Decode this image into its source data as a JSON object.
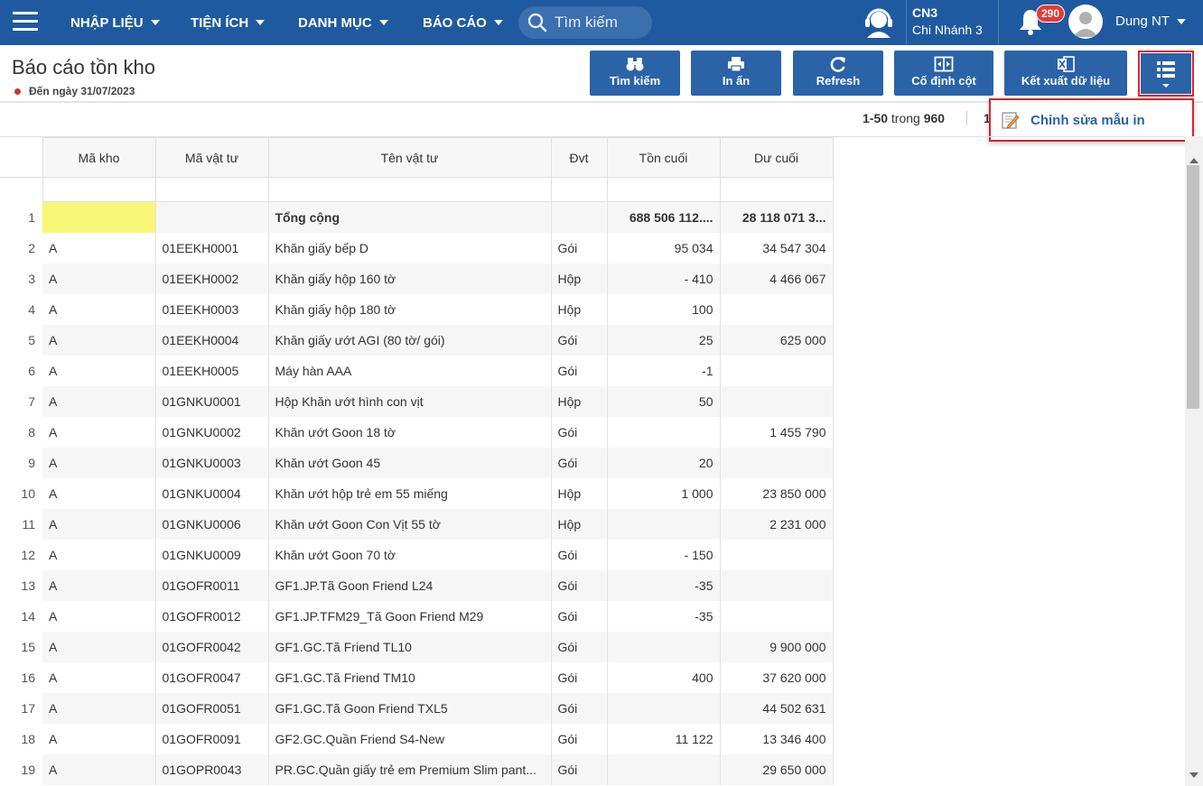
{
  "nav": {
    "menus": [
      "NHẬP LIỆU",
      "TIỆN ÍCH",
      "DANH MỤC",
      "BÁO CÁO"
    ],
    "search_placeholder": "Tìm kiếm",
    "branch_code": "CN3",
    "branch_name": "Chi Nhánh 3",
    "notification_count": "290",
    "user_name": "Dung NT"
  },
  "page": {
    "title": "Báo cáo tồn kho",
    "subtitle": "Đến ngày 31/07/2023"
  },
  "toolbar": {
    "search": "Tìm kiếm",
    "print": "In ấn",
    "refresh": "Refresh",
    "freeze": "Cố định cột",
    "export": "Kết xuất dữ liệu"
  },
  "dropdown": {
    "edit_template": "Chỉnh sửa mẫu in"
  },
  "pager": {
    "range": "1-50",
    "of": "trong",
    "total": "960",
    "page": "1"
  },
  "table": {
    "columns": [
      "Mã kho",
      "Mã vật tư",
      "Tên vật tư",
      "Đvt",
      "Tồn cuối",
      "Dư cuối"
    ],
    "total": {
      "idx": "1",
      "label": "Tổng cộng",
      "ton": "688 506 112....",
      "du": "28 118 071 3..."
    },
    "rows": [
      [
        "2",
        "A",
        "01EEKH0001",
        "Khăn giấy bếp D",
        "Gói",
        "95 034",
        "34 547 304"
      ],
      [
        "3",
        "A",
        "01EEKH0002",
        "Khăn giấy hộp 160 tờ",
        "Hộp",
        "- 410",
        "4 466 067"
      ],
      [
        "4",
        "A",
        "01EEKH0003",
        "Khăn giấy hộp 180 tờ",
        "Hộp",
        "100",
        ""
      ],
      [
        "5",
        "A",
        "01EEKH0004",
        "Khăn giấy ướt AGI (80 tờ/ gói)",
        "Gói",
        "25",
        "625 000"
      ],
      [
        "6",
        "A",
        "01EEKH0005",
        "Máy hàn AAA",
        "Gói",
        "-1",
        ""
      ],
      [
        "7",
        "A",
        "01GNKU0001",
        "Hộp Khăn ướt hình con vịt",
        "Hộp",
        "50",
        ""
      ],
      [
        "8",
        "A",
        "01GNKU0002",
        "Khăn ướt Goon 18 tờ",
        "Gói",
        "",
        "1 455 790"
      ],
      [
        "9",
        "A",
        "01GNKU0003",
        "Khăn ướt Goon 45",
        "Gói",
        "20",
        ""
      ],
      [
        "10",
        "A",
        "01GNKU0004",
        "Khăn ướt hộp trẻ em 55 miếng",
        "Hộp",
        "1 000",
        "23 850 000"
      ],
      [
        "11",
        "A",
        "01GNKU0006",
        "Khăn ướt Goon Con Vịt 55 tờ",
        "Hộp",
        "",
        "2 231 000"
      ],
      [
        "12",
        "A",
        "01GNKU0009",
        "Khăn ướt Goon 70 tờ",
        "Gói",
        "- 150",
        ""
      ],
      [
        "13",
        "A",
        "01GOFR0011",
        "GF1.JP.Tã Goon Friend L24",
        "Gói",
        "-35",
        ""
      ],
      [
        "14",
        "A",
        "01GOFR0012",
        "GF1.JP.TFM29_Tã Goon Friend M29",
        "Gói",
        "-35",
        ""
      ],
      [
        "15",
        "A",
        "01GOFR0042",
        "GF1.GC.Tã Friend TL10",
        "Gói",
        "",
        "9 900 000"
      ],
      [
        "16",
        "A",
        "01GOFR0047",
        "GF1.GC.Tã Friend TM10",
        "Gói",
        "400",
        "37 620 000"
      ],
      [
        "17",
        "A",
        "01GOFR0051",
        "GF1.GC.Tã Goon Friend TXL5",
        "Gói",
        "",
        "44 502 631"
      ],
      [
        "18",
        "A",
        "01GOFR0091",
        "GF2.GC.Quần Friend S4-New",
        "Gói",
        "11 122",
        "13 346 400"
      ],
      [
        "19",
        "A",
        "01GOPR0043",
        "PR.GC.Quần giấy trẻ em Premium Slim pant...",
        "Gói",
        "",
        "29 650 000"
      ]
    ]
  },
  "colors": {
    "primary": "#1f5aa0",
    "button": "#2a63a8",
    "highlight": "#d9232d",
    "yellow": "#f8f777"
  }
}
